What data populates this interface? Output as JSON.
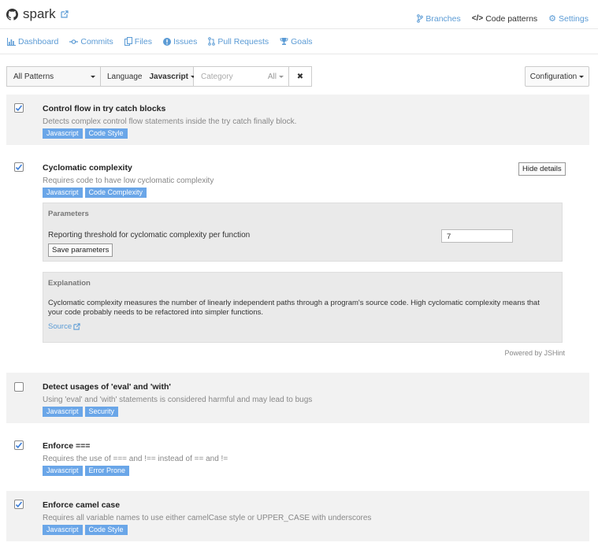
{
  "repo": {
    "name": "spark"
  },
  "top_nav": [
    {
      "label": "Branches",
      "icon": "branch-icon",
      "active": false
    },
    {
      "label": "Code patterns",
      "icon": "code-icon",
      "active": true
    },
    {
      "label": "Settings",
      "icon": "gear-icon",
      "active": false
    }
  ],
  "sub_nav": [
    {
      "label": "Dashboard",
      "icon": "bar-chart-icon"
    },
    {
      "label": "Commits",
      "icon": "commit-icon"
    },
    {
      "label": "Files",
      "icon": "files-icon"
    },
    {
      "label": "Issues",
      "icon": "issues-icon"
    },
    {
      "label": "Pull Requests",
      "icon": "pull-request-icon"
    },
    {
      "label": "Goals",
      "icon": "trophy-icon"
    }
  ],
  "filters": {
    "patterns": "All Patterns",
    "language_label": "Language",
    "language_value": "Javascript",
    "category_placeholder": "Category",
    "category_value": "All",
    "clear_label": "✖",
    "configuration": "Configuration"
  },
  "patterns": [
    {
      "title": "Control flow in try catch blocks",
      "description": "Detects complex control flow statements inside the try catch finally block.",
      "tags": [
        "Javascript",
        "Code Style"
      ],
      "checked": true
    },
    {
      "title": "Cyclomatic complexity",
      "description": "Requires code to have low cyclomatic complexity",
      "tags": [
        "Javascript",
        "Code Complexity"
      ],
      "checked": true,
      "hide_details_label": "Hide details",
      "parameters": {
        "heading": "Parameters",
        "label": "Reporting threshold for cyclomatic complexity per function",
        "value": "7",
        "save_label": "Save parameters"
      },
      "explanation": {
        "heading": "Explanation",
        "line1": "Cyclomatic complexity measures the number of linearly independent paths through a program's source code. High cyclomatic complexity means that",
        "line2": "your code probably needs to be refactored into simpler functions.",
        "source_label": "Source"
      },
      "powered_by": "Powered by JSHint"
    },
    {
      "title": "Detect usages of 'eval' and 'with'",
      "description": "Using 'eval' and 'with' statements is considered harmful and may lead to bugs",
      "tags": [
        "Javascript",
        "Security"
      ],
      "checked": false
    },
    {
      "title": "Enforce ===",
      "description": "Requires the use of === and !== instead of == and !=",
      "tags": [
        "Javascript",
        "Error Prone"
      ],
      "checked": true
    },
    {
      "title": "Enforce camel case",
      "description": "Requires all variable names to use either camelCase style or UPPER_CASE with underscores",
      "tags": [
        "Javascript",
        "Code Style"
      ],
      "checked": true
    }
  ],
  "colors": {
    "accent": "#5b9bd5",
    "tag": "#6aa6e8",
    "row_bg": "#f2f2f2"
  }
}
